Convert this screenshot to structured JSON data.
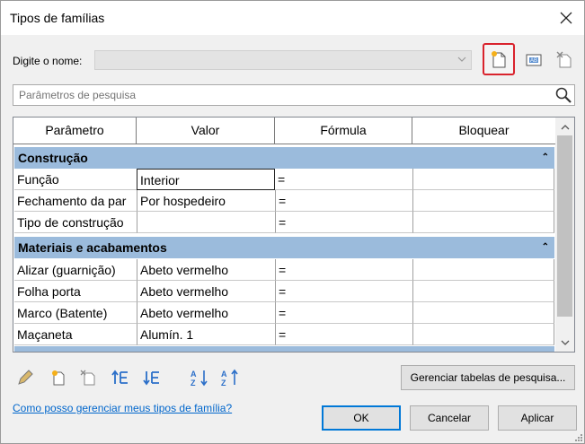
{
  "window": {
    "title": "Tipos de famílias"
  },
  "name_field": {
    "label": "Digite o nome:",
    "value": ""
  },
  "search": {
    "placeholder": "Parâmetros de pesquisa"
  },
  "table": {
    "headers": [
      "Parâmetro",
      "Valor",
      "Fórmula",
      "Bloquear"
    ],
    "groups": [
      {
        "title": "Construção",
        "rows": [
          {
            "param": "Função",
            "value": "Interior",
            "formula": "="
          },
          {
            "param": "Fechamento da par",
            "value": "Por hospedeiro",
            "formula": "="
          },
          {
            "param": "Tipo de construção",
            "value": "",
            "formula": "="
          }
        ]
      },
      {
        "title": "Materiais e acabamentos",
        "rows": [
          {
            "param": "Alizar (guarnição)",
            "value": "Abeto vermelho",
            "formula": "="
          },
          {
            "param": "Folha porta",
            "value": "Abeto vermelho",
            "formula": "="
          },
          {
            "param": "Marco (Batente)",
            "value": "Abeto vermelho",
            "formula": "="
          },
          {
            "param": "Maçaneta",
            "value": "Alumín. 1",
            "formula": "="
          }
        ]
      }
    ]
  },
  "buttons": {
    "lookup": "Gerenciar tabelas de pesquisa...",
    "ok": "OK",
    "cancel": "Cancelar",
    "apply": "Aplicar"
  },
  "help_link": "Como posso gerenciar meus tipos de família?",
  "colors": {
    "group_header": "#9bbbdc",
    "highlight": "#d9232d",
    "link": "#0066cc"
  }
}
